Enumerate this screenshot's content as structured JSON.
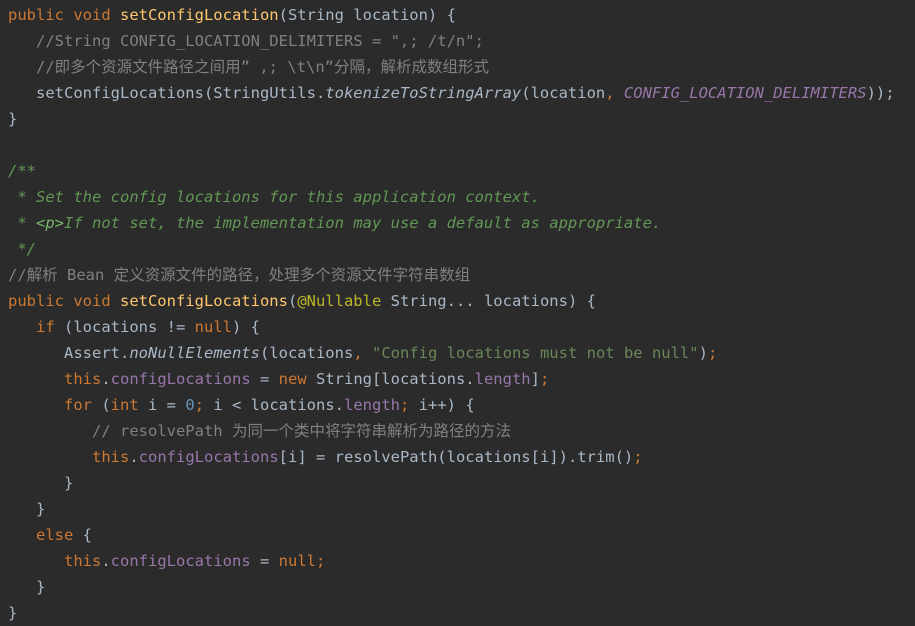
{
  "code": {
    "lines": [
      [
        {
          "t": "public void ",
          "c": "kw"
        },
        {
          "t": "setConfigLocation",
          "c": "fn"
        },
        {
          "t": "(String location) {",
          "c": "id"
        }
      ],
      [
        {
          "t": "   //String CONFIG_LOCATION_DELIMITERS = \",; /t/n\";",
          "c": "cmt"
        }
      ],
      [
        {
          "t": "   //即多个资源文件路径之间用” ,; \\t\\n”分隔，解析成数组形式",
          "c": "cmt"
        }
      ],
      [
        {
          "t": "   setConfigLocations(StringUtils.",
          "c": "id"
        },
        {
          "t": "tokenizeToStringArray",
          "c": "stat"
        },
        {
          "t": "(location",
          "c": "id"
        },
        {
          "t": ", ",
          "c": "kw"
        },
        {
          "t": "CONFIG_LOCATION_DELIMITERS",
          "c": "const"
        },
        {
          "t": "));",
          "c": "id"
        }
      ],
      [
        {
          "t": "}",
          "c": "id"
        }
      ],
      [],
      [
        {
          "t": "/**",
          "c": "doc"
        }
      ],
      [
        {
          "t": " * Set the config locations for this application context.",
          "c": "doc"
        }
      ],
      [
        {
          "t": " * ",
          "c": "doc"
        },
        {
          "t": "<p>",
          "c": "doctag"
        },
        {
          "t": "If not set, the implementation may use a default as appropriate.",
          "c": "doc"
        }
      ],
      [
        {
          "t": " */",
          "c": "doc"
        }
      ],
      [
        {
          "t": "//解析 Bean 定义资源文件的路径，处理多个资源文件字符串数组",
          "c": "cmt"
        }
      ],
      [
        {
          "t": "public void ",
          "c": "kw"
        },
        {
          "t": "setConfigLocations",
          "c": "fn"
        },
        {
          "t": "(",
          "c": "id"
        },
        {
          "t": "@Nullable",
          "c": "ann"
        },
        {
          "t": " String... locations) {",
          "c": "id"
        }
      ],
      [
        {
          "t": "   ",
          "c": "id"
        },
        {
          "t": "if",
          "c": "kw"
        },
        {
          "t": " (locations != ",
          "c": "id"
        },
        {
          "t": "null",
          "c": "kw"
        },
        {
          "t": ") {",
          "c": "id"
        }
      ],
      [
        {
          "t": "      Assert.",
          "c": "id"
        },
        {
          "t": "noNullElements",
          "c": "stat"
        },
        {
          "t": "(locations",
          "c": "id"
        },
        {
          "t": ", ",
          "c": "kw"
        },
        {
          "t": "\"Config locations must not be null\"",
          "c": "str"
        },
        {
          "t": ")",
          "c": "id"
        },
        {
          "t": ";",
          "c": "kw"
        }
      ],
      [
        {
          "t": "      ",
          "c": "id"
        },
        {
          "t": "this",
          "c": "kw"
        },
        {
          "t": ".",
          "c": "id"
        },
        {
          "t": "configLocations",
          "c": "field"
        },
        {
          "t": " = ",
          "c": "id"
        },
        {
          "t": "new",
          "c": "kw"
        },
        {
          "t": " String[locations.",
          "c": "id"
        },
        {
          "t": "length",
          "c": "field"
        },
        {
          "t": "]",
          "c": "id"
        },
        {
          "t": ";",
          "c": "kw"
        }
      ],
      [
        {
          "t": "      ",
          "c": "id"
        },
        {
          "t": "for",
          "c": "kw"
        },
        {
          "t": " (",
          "c": "id"
        },
        {
          "t": "int",
          "c": "kw"
        },
        {
          "t": " i = ",
          "c": "id"
        },
        {
          "t": "0",
          "c": "num"
        },
        {
          "t": "; ",
          "c": "kw"
        },
        {
          "t": "i < locations.",
          "c": "id"
        },
        {
          "t": "length",
          "c": "field"
        },
        {
          "t": "; ",
          "c": "kw"
        },
        {
          "t": "i++) {",
          "c": "id"
        }
      ],
      [
        {
          "t": "         // resolvePath 为同一个类中将字符串解析为路径的方法",
          "c": "cmt"
        }
      ],
      [
        {
          "t": "         ",
          "c": "id"
        },
        {
          "t": "this",
          "c": "kw"
        },
        {
          "t": ".",
          "c": "id"
        },
        {
          "t": "configLocations",
          "c": "field"
        },
        {
          "t": "[i] = resolvePath(locations[i]).trim()",
          "c": "id"
        },
        {
          "t": ";",
          "c": "kw"
        }
      ],
      [
        {
          "t": "      }",
          "c": "id"
        }
      ],
      [
        {
          "t": "   }",
          "c": "id"
        }
      ],
      [
        {
          "t": "   ",
          "c": "id"
        },
        {
          "t": "else",
          "c": "kw"
        },
        {
          "t": " {",
          "c": "id"
        }
      ],
      [
        {
          "t": "      ",
          "c": "id"
        },
        {
          "t": "this",
          "c": "kw"
        },
        {
          "t": ".",
          "c": "id"
        },
        {
          "t": "configLocations",
          "c": "field"
        },
        {
          "t": " = ",
          "c": "id"
        },
        {
          "t": "null",
          "c": "kw"
        },
        {
          "t": ";",
          "c": "kw"
        }
      ],
      [
        {
          "t": "   }",
          "c": "id"
        }
      ],
      [
        {
          "t": "}",
          "c": "id"
        }
      ]
    ]
  }
}
